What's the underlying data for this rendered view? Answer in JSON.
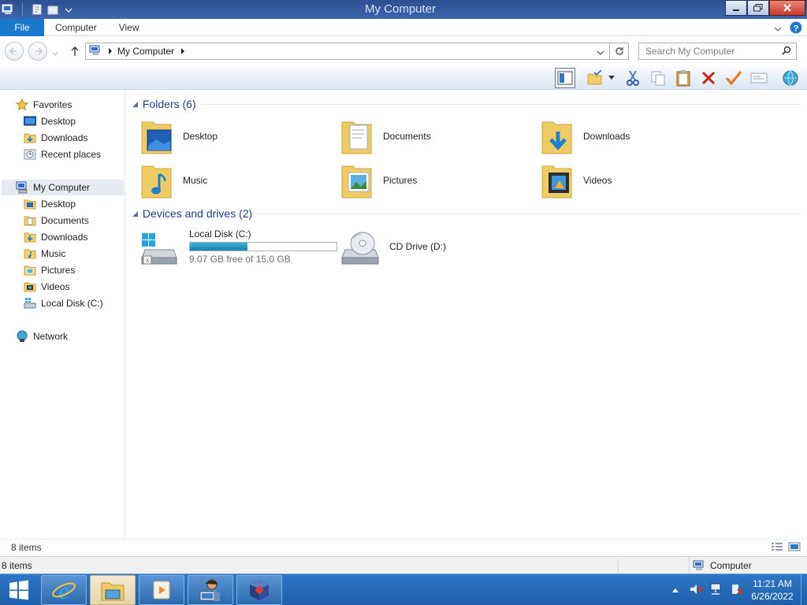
{
  "window": {
    "title": "My Computer"
  },
  "ribbon": {
    "tabs": [
      "File",
      "Computer",
      "View"
    ]
  },
  "address": {
    "path": "My Computer",
    "search_placeholder": "Search My Computer"
  },
  "nav_pane": {
    "favorites_label": "Favorites",
    "favorites": [
      "Desktop",
      "Downloads",
      "Recent places"
    ],
    "computer_label": "My Computer",
    "computer_items": [
      "Desktop",
      "Documents",
      "Downloads",
      "Music",
      "Pictures",
      "Videos",
      "Local Disk (C:)"
    ],
    "network_label": "Network"
  },
  "content": {
    "folders_header": "Folders (6)",
    "folders": [
      "Desktop",
      "Documents",
      "Downloads",
      "Music",
      "Pictures",
      "Videos"
    ],
    "devices_header": "Devices and drives (2)",
    "drives": [
      {
        "name": "Local Disk (C:)",
        "free_text": "9.07 GB free of 15.0 GB",
        "used_fraction": 0.395
      },
      {
        "name": "CD Drive (D:)"
      }
    ]
  },
  "status": {
    "item_count": "8 items",
    "bottom_item_count": "8 items",
    "zone_label": "Computer"
  },
  "taskbar": {
    "time": "11:21 AM",
    "date": "6/26/2022"
  },
  "colors": {
    "accent": "#1979ca",
    "group_header": "#1e3f8a",
    "taskbar": "#2d77c7",
    "disk_bar": "#26a0da"
  }
}
